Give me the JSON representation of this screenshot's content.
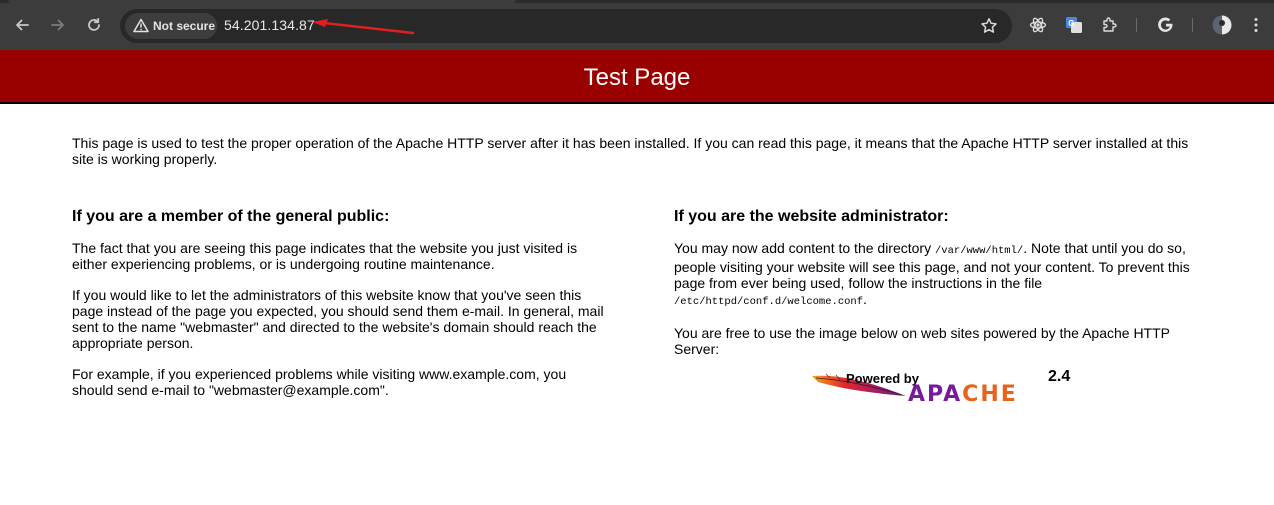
{
  "browser": {
    "security_label": "Not secure",
    "url": "54.201.134.87"
  },
  "icons": {
    "back": "back-arrow-icon",
    "forward": "forward-arrow-icon",
    "reload": "reload-icon",
    "warning": "warning-triangle-icon",
    "bookmark": "star-icon",
    "extensions": [
      "react-devtools-icon",
      "google-translate-icon",
      "puzzle-extensions-icon",
      "google-icon",
      "profile-avatar-icon",
      "kebab-menu-icon"
    ]
  },
  "colors": {
    "banner": "#990000",
    "annotation_arrow": "#e02020"
  },
  "page": {
    "title": "Test Page",
    "intro": "This page is used to test the proper operation of the Apache HTTP server after it has been installed. If you can read this page, it means that the Apache HTTP server installed at this site is working properly.",
    "public": {
      "heading": "If you are a member of the general public:",
      "p1": "The fact that you are seeing this page indicates that the website you just visited is either experiencing problems, or is undergoing routine maintenance.",
      "p2": "If you would like to let the administrators of this website know that you've seen this page instead of the page you expected, you should send them e-mail. In general, mail sent to the name \"webmaster\" and directed to the website's domain should reach the appropriate person.",
      "p3": "For example, if you experienced problems while visiting www.example.com, you should send e-mail to \"webmaster@example.com\"."
    },
    "admin": {
      "heading": "If you are the website administrator:",
      "p1_a": "You may now add content to the directory ",
      "p1_path": "/var/www/html/",
      "p1_b": ". Note that until you do so, people visiting your website will see this page, and not your content. To prevent this page from ever being used, follow the instructions in the file ",
      "p1_file": "/etc/httpd/conf.d/welcome.conf",
      "p1_c": ".",
      "p2": "You are free to use the image below on web sites powered by the Apache HTTP Server:"
    },
    "logo": {
      "powered_by": "Powered by",
      "version": "2.4",
      "apache_a": "APA",
      "apache_b": "CHE"
    }
  }
}
